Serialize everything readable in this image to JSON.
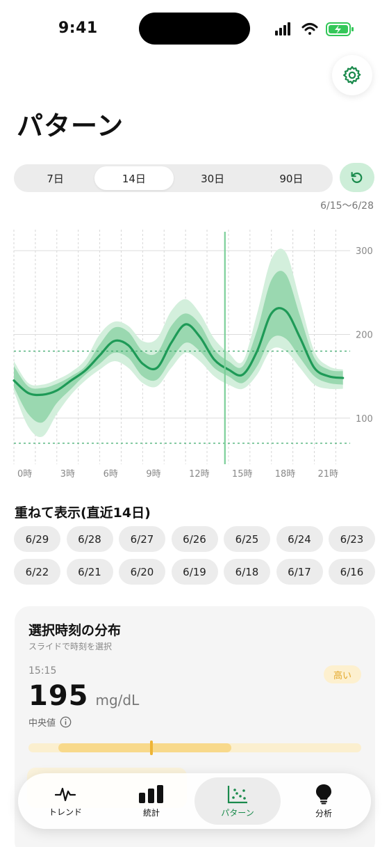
{
  "status_bar": {
    "time": "9:41"
  },
  "header": {
    "title": "パターン"
  },
  "range_selector": {
    "options": [
      "7日",
      "14日",
      "30日",
      "90日"
    ],
    "selected": "14日",
    "date_range": "6/15～6/28"
  },
  "chart_data": {
    "type": "area",
    "x_ticks": [
      "0時",
      "3時",
      "6時",
      "9時",
      "12時",
      "15時",
      "18時",
      "21時"
    ],
    "y_ticks": [
      "300",
      "200",
      "100"
    ],
    "ylim": [
      45,
      325
    ],
    "xlim": [
      0,
      23.5
    ],
    "target_range": [
      70,
      180
    ],
    "selected_hour": 14.75,
    "series": [
      {
        "name": "",
        "role": "median",
        "x": [
          0,
          1,
          2,
          3,
          4,
          5,
          6,
          7,
          8,
          9,
          10,
          11,
          12,
          13,
          14,
          15,
          16,
          17,
          18,
          19,
          20,
          21,
          22,
          23
        ],
        "y": [
          145,
          130,
          128,
          133,
          145,
          157,
          175,
          192,
          187,
          165,
          160,
          190,
          212,
          197,
          170,
          158,
          152,
          180,
          225,
          228,
          196,
          160,
          150,
          148
        ]
      },
      {
        "name": "",
        "role": "iqr_upper",
        "x": [
          0,
          1,
          2,
          3,
          4,
          5,
          6,
          7,
          8,
          9,
          10,
          11,
          12,
          13,
          14,
          15,
          16,
          17,
          18,
          19,
          20,
          21,
          22,
          23
        ],
        "y": [
          162,
          138,
          136,
          141,
          150,
          162,
          188,
          208,
          203,
          180,
          178,
          210,
          225,
          212,
          182,
          168,
          162,
          205,
          265,
          272,
          222,
          172,
          158,
          156
        ]
      },
      {
        "name": "",
        "role": "iqr_lower",
        "x": [
          0,
          1,
          2,
          3,
          4,
          5,
          6,
          7,
          8,
          9,
          10,
          11,
          12,
          13,
          14,
          15,
          16,
          17,
          18,
          19,
          20,
          21,
          22,
          23
        ],
        "y": [
          137,
          105,
          95,
          118,
          135,
          152,
          165,
          178,
          172,
          150,
          146,
          170,
          190,
          180,
          160,
          150,
          142,
          162,
          195,
          195,
          172,
          150,
          142,
          140
        ]
      },
      {
        "name": "",
        "role": "p90_upper",
        "x": [
          0,
          1,
          2,
          3,
          4,
          5,
          6,
          7,
          8,
          9,
          10,
          11,
          12,
          13,
          14,
          15,
          16,
          17,
          18,
          19,
          20,
          21,
          22,
          23
        ],
        "y": [
          168,
          142,
          140,
          146,
          155,
          170,
          200,
          215,
          210,
          192,
          195,
          228,
          242,
          225,
          195,
          178,
          168,
          225,
          290,
          298,
          240,
          180,
          162,
          158
        ]
      },
      {
        "name": "",
        "role": "p10_lower",
        "x": [
          0,
          1,
          2,
          3,
          4,
          5,
          6,
          7,
          8,
          9,
          10,
          11,
          12,
          13,
          14,
          15,
          16,
          17,
          18,
          19,
          20,
          21,
          22,
          23
        ],
        "y": [
          132,
          90,
          78,
          105,
          128,
          145,
          158,
          168,
          160,
          142,
          138,
          160,
          178,
          168,
          150,
          140,
          135,
          152,
          182,
          180,
          160,
          140,
          135,
          135
        ]
      }
    ],
    "colors": {
      "median": "#1e9a57",
      "iqr": "#8fd3a8",
      "outer": "#d3efdc",
      "selected_line": "#7ccf99",
      "target_line": "#3aa86a",
      "grid": "#dcdcdc"
    }
  },
  "overlay": {
    "title": "重ねて表示(直近14日)",
    "dates": [
      "6/29",
      "6/28",
      "6/27",
      "6/26",
      "6/25",
      "6/24",
      "6/23",
      "6/22",
      "6/21",
      "6/20",
      "6/19",
      "6/18",
      "6/17",
      "6/16"
    ]
  },
  "distribution_card": {
    "title": "選択時刻の分布",
    "subtitle": "スライドで時刻を選択",
    "time": "15:15",
    "badge": "高い",
    "value": "195",
    "unit": "mg/dL",
    "median_label": "中央値",
    "bar_range": [
      0.09,
      0.61
    ],
    "marker_fraction": 0.37
  },
  "tabs": [
    {
      "label": "トレンド",
      "icon": "pulse-icon"
    },
    {
      "label": "統計",
      "icon": "bar-chart-icon"
    },
    {
      "label": "パターン",
      "icon": "scatter-icon",
      "active": true
    },
    {
      "label": "分析",
      "icon": "lightbulb-icon"
    }
  ],
  "colors": {
    "accent": "#1a8a4c",
    "badge_text": "#e3a92c"
  }
}
